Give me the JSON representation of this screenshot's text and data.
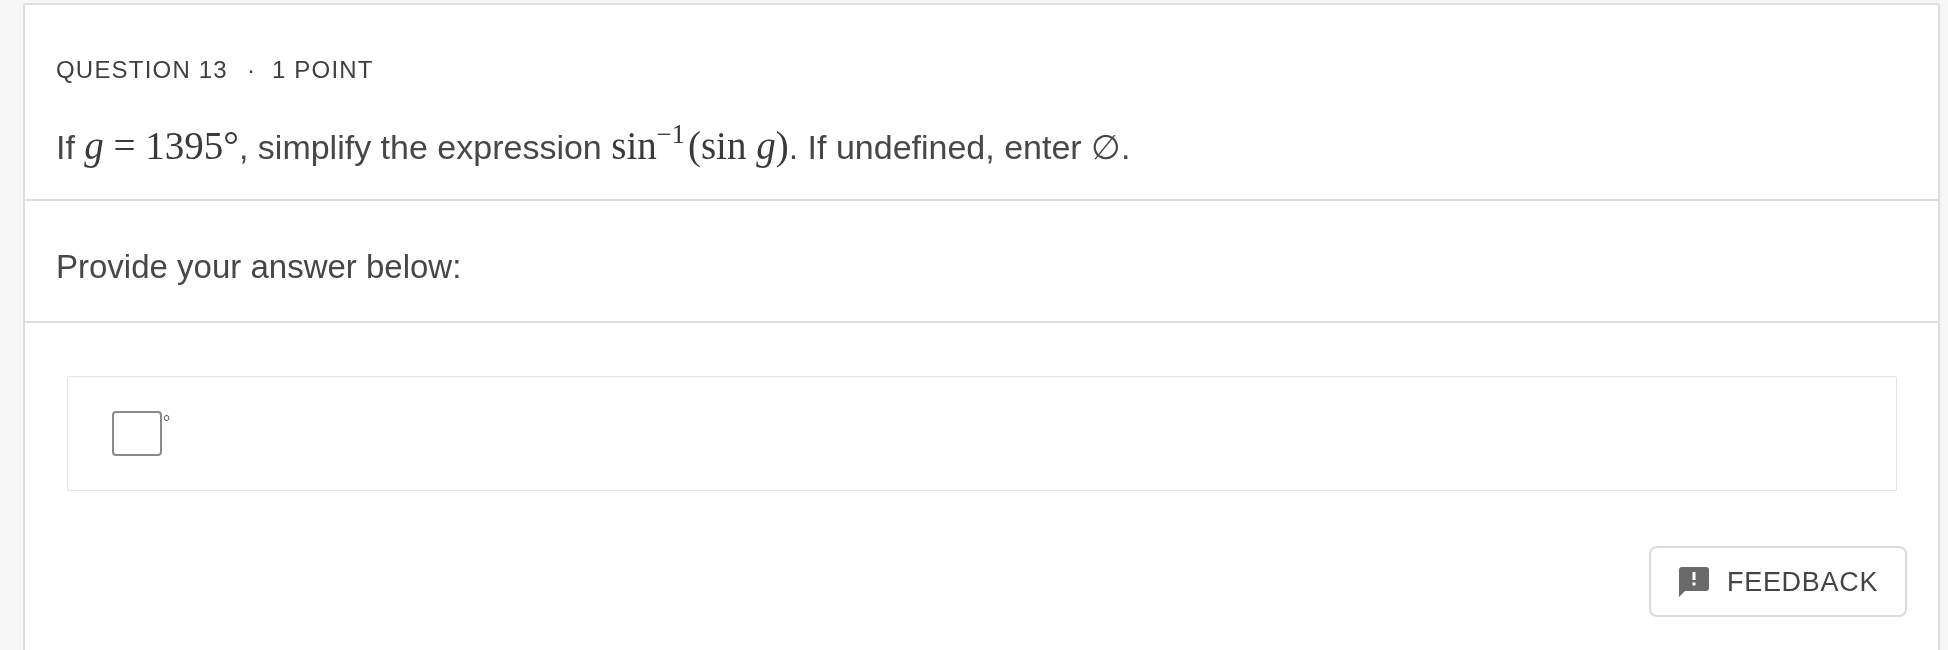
{
  "question": {
    "label": "QUESTION 13",
    "separator": "·",
    "points": "1 POINT",
    "prompt": [
      {
        "kind": "text",
        "text": "If "
      },
      {
        "kind": "math",
        "text": "*g* = 1395°"
      },
      {
        "kind": "text",
        "text": ", simplify the expression "
      },
      {
        "kind": "math",
        "text": "sin$^{−1}$(sin *g*)"
      },
      {
        "kind": "text",
        "text": ". If undefined, enter ∅."
      }
    ]
  },
  "answer_section": {
    "instruction": "Provide your answer below:",
    "unit": "°"
  },
  "feedback_button": {
    "label": "FEEDBACK"
  }
}
